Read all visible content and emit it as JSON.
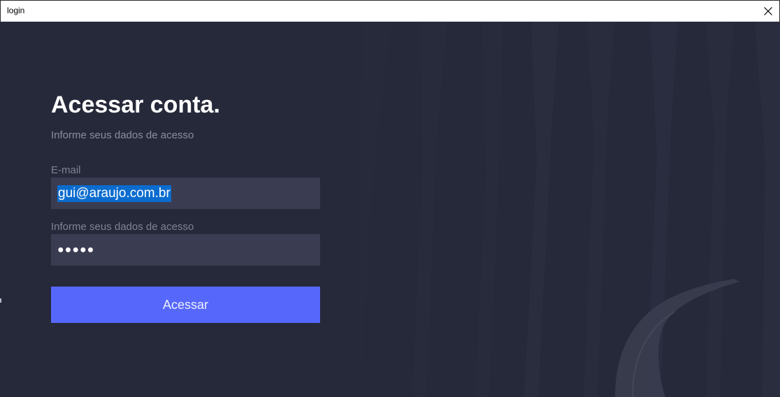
{
  "window": {
    "title": "login",
    "close_icon": "close-icon"
  },
  "login": {
    "heading": "Acessar conta.",
    "subheading": "Informe seus dados de acesso",
    "email": {
      "label": "E-mail",
      "value": "gui@araujo.com.br"
    },
    "password": {
      "label": "Informe seus dados de acesso",
      "masked_value": "●●●●●"
    },
    "submit_label": "Acessar"
  },
  "colors": {
    "background": "#262939",
    "input_background": "#3a3d52",
    "accent": "#5667fb",
    "selection": "#0a6ccf"
  }
}
